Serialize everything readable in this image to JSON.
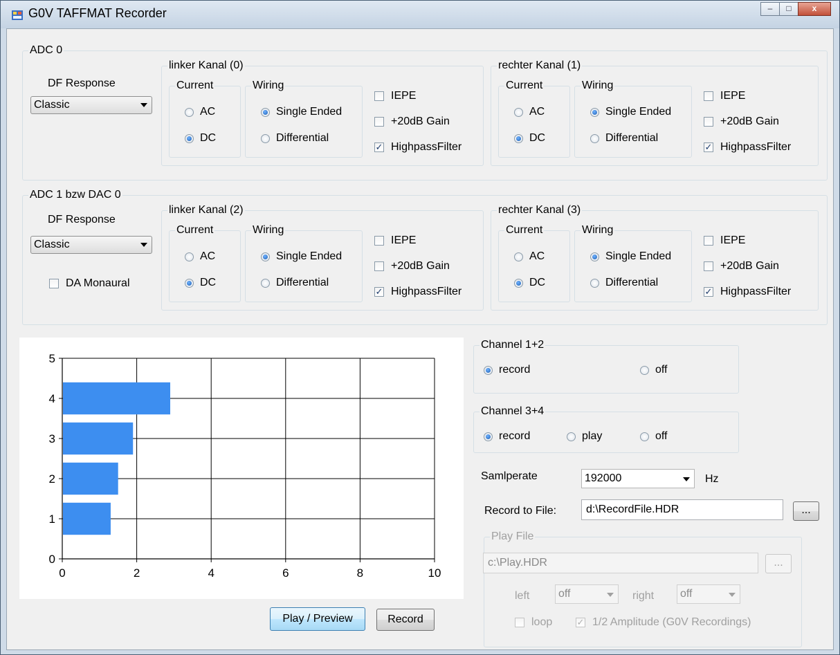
{
  "window": {
    "title": "G0V TAFFMAT Recorder",
    "minimize": "–",
    "maximize": "□",
    "close": "x"
  },
  "adc0": {
    "legend": "ADC 0",
    "df_label": "DF Response",
    "df_value": "Classic",
    "left": {
      "legend": "linker Kanal (0)",
      "current_legend": "Current",
      "ac": "AC",
      "dc": "DC",
      "current_selected": "DC",
      "wiring_legend": "Wiring",
      "single": "Single Ended",
      "diff": "Differential",
      "wiring_selected": "Single Ended",
      "iepe": "IEPE",
      "gain": "+20dB Gain",
      "hp": "HighpassFilter",
      "iepe_checked": false,
      "gain_checked": false,
      "hp_checked": true
    },
    "right": {
      "legend": "rechter Kanal (1)",
      "current_legend": "Current",
      "ac": "AC",
      "dc": "DC",
      "current_selected": "DC",
      "wiring_legend": "Wiring",
      "single": "Single Ended",
      "diff": "Differential",
      "wiring_selected": "Single Ended",
      "iepe": "IEPE",
      "gain": "+20dB Gain",
      "hp": "HighpassFilter",
      "iepe_checked": false,
      "gain_checked": false,
      "hp_checked": true
    }
  },
  "adc1": {
    "legend": "ADC 1 bzw DAC 0",
    "df_label": "DF Response",
    "df_value": "Classic",
    "mono_label": "DA Monaural",
    "mono_checked": false,
    "left": {
      "legend": "linker Kanal (2)",
      "current_legend": "Current",
      "ac": "AC",
      "dc": "DC",
      "current_selected": "DC",
      "wiring_legend": "Wiring",
      "single": "Single Ended",
      "diff": "Differential",
      "wiring_selected": "Single Ended",
      "iepe": "IEPE",
      "gain": "+20dB Gain",
      "hp": "HighpassFilter",
      "iepe_checked": false,
      "gain_checked": false,
      "hp_checked": true
    },
    "right": {
      "legend": "rechter Kanal (3)",
      "current_legend": "Current",
      "ac": "AC",
      "dc": "DC",
      "current_selected": "DC",
      "wiring_legend": "Wiring",
      "single": "Single Ended",
      "diff": "Differential",
      "wiring_selected": "Single Ended",
      "iepe": "IEPE",
      "gain": "+20dB Gain",
      "hp": "HighpassFilter",
      "iepe_checked": false,
      "gain_checked": false,
      "hp_checked": true
    }
  },
  "chart_data": {
    "type": "bar",
    "orientation": "horizontal",
    "categories": [
      "1",
      "2",
      "3",
      "4"
    ],
    "values": [
      1.3,
      1.5,
      1.9,
      2.9
    ],
    "xlim": [
      0,
      10
    ],
    "ylim": [
      0,
      5
    ],
    "xticks": [
      "0",
      "2",
      "4",
      "6",
      "8",
      "10"
    ],
    "yticks": [
      "0",
      "1",
      "2",
      "3",
      "4",
      "5"
    ],
    "bar_color": "#3d8ef0",
    "grid": true
  },
  "buttons": {
    "play": "Play / Preview",
    "record": "Record",
    "browse_record": "...",
    "browse_play": "..."
  },
  "channel12": {
    "legend": "Channel 1+2",
    "record": "record",
    "off": "off",
    "selected": "record"
  },
  "channel34": {
    "legend": "Channel 3+4",
    "record": "record",
    "play": "play",
    "off": "off",
    "selected": "record"
  },
  "samplerate": {
    "label": "Samlperate",
    "value": "192000",
    "unit": "Hz"
  },
  "record_file": {
    "label": "Record to File:",
    "value": "d:\\RecordFile.HDR"
  },
  "play_file": {
    "legend": "Play File",
    "value": "c:\\Play.HDR",
    "left_label": "left",
    "left_value": "off",
    "right_label": "right",
    "right_value": "off",
    "loop_label": "loop",
    "loop_checked": false,
    "half_label": "1/2 Amplitude (G0V Recordings)",
    "half_checked": true
  }
}
